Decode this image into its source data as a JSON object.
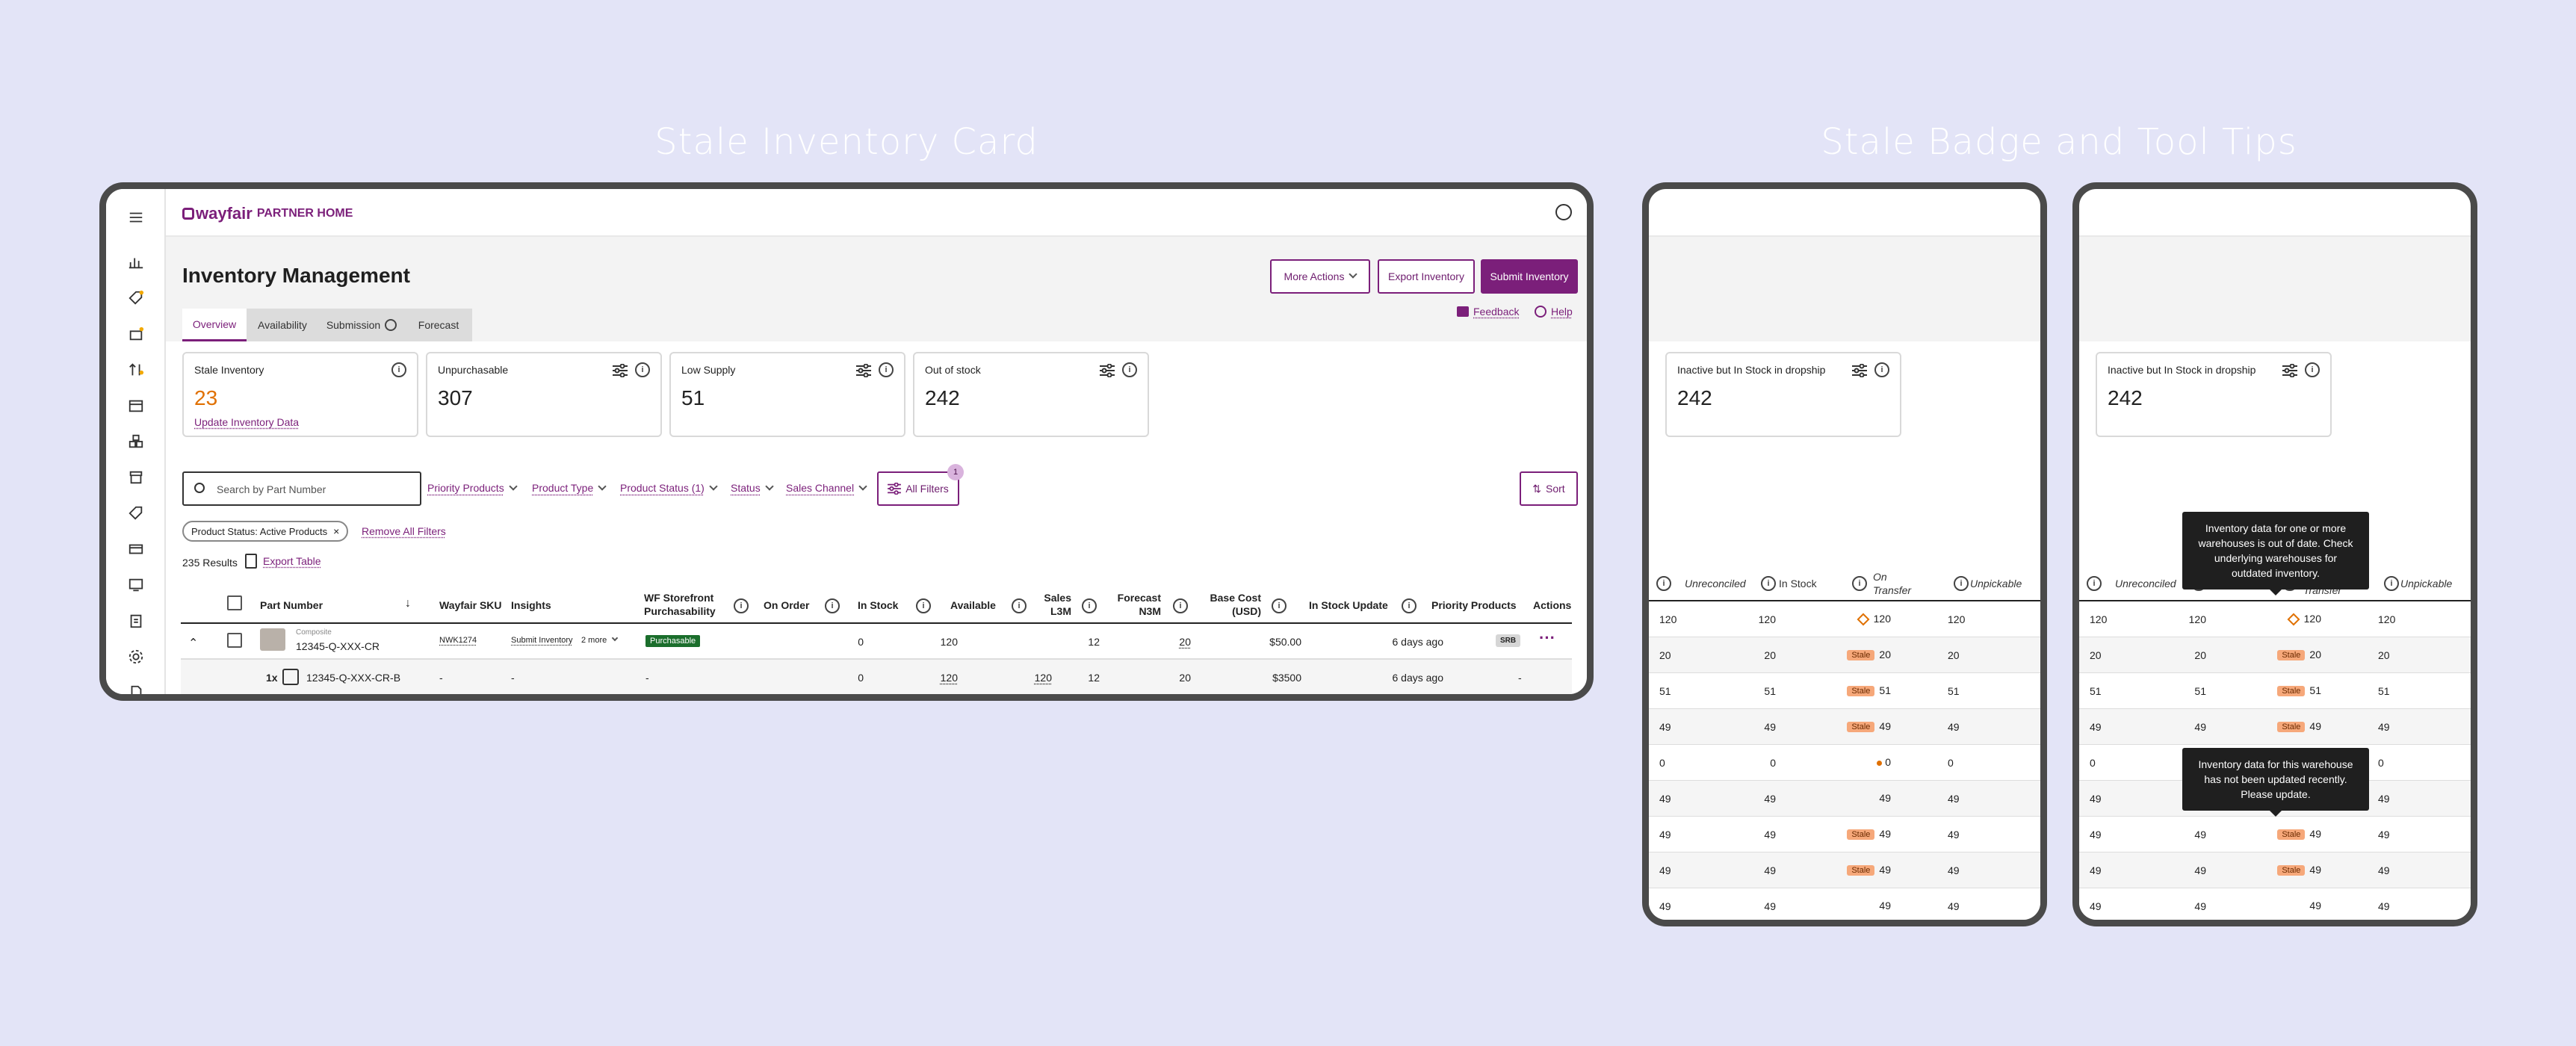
{
  "titles": {
    "card": "Stale Inventory Card",
    "badge": "Stale Badge and Tool Tips"
  },
  "brand": {
    "logo": "wayfair",
    "partner_home": "PARTNER HOME",
    "color": "#7b1f7a"
  },
  "page": {
    "title": "Inventory Management"
  },
  "actions": {
    "more": "More Actions",
    "export": "Export Inventory",
    "submit": "Submit Inventory",
    "feedback": "Feedback",
    "help": "Help"
  },
  "tabs": [
    "Overview",
    "Availability",
    "Submission",
    "Forecast"
  ],
  "cards": [
    {
      "title": "Stale Inventory",
      "value": "23",
      "link": "Update Inventory Data",
      "value_color": "#e07000"
    },
    {
      "title": "Unpurchasable",
      "value": "307"
    },
    {
      "title": "Low Supply",
      "value": "51"
    },
    {
      "title": "Out of stock",
      "value": "242"
    }
  ],
  "search": {
    "placeholder": "Search by Part Number"
  },
  "filters": [
    "Priority Products",
    "Product Type",
    "Product Status (1)",
    "Status",
    "Sales Channel"
  ],
  "all_filters": {
    "label": "All Filters",
    "count": "1"
  },
  "sort": "Sort",
  "chip": {
    "label": "Product Status: Active Products",
    "remove_all": "Remove All Filters"
  },
  "results": {
    "count": "235 Results",
    "export": "Export Table"
  },
  "table": {
    "headers": [
      "Part Number",
      "Wayfair SKU",
      "Insights",
      "WF Storefront Purchasability",
      "On Order",
      "In Stock",
      "Available",
      "Sales L3M",
      "Forecast N3M",
      "Base Cost (USD)",
      "In Stock Update",
      "Priority Products",
      "Actions"
    ],
    "row1": {
      "kind": "Composite",
      "part": "12345-Q-XXX-CR",
      "sku": "NWK1274",
      "insight": "Submit Inventory",
      "more": "2 more",
      "purch": "Purchasable",
      "on_order": "0",
      "in_stock": "120",
      "sales": "12",
      "forecast": "20",
      "cost": "$50.00",
      "update": "6 days ago",
      "priority": "SRB"
    },
    "row2": {
      "qty": "1x",
      "part": "12345-Q-XXX-CR-B",
      "sku": "-",
      "insight": "-",
      "purch": "-",
      "on_order": "0",
      "in_stock": "120",
      "available": "120",
      "sales": "12",
      "forecast": "20",
      "cost": "$3500",
      "update": "6 days ago",
      "priority": "-"
    }
  },
  "side": {
    "card_title": "Inactive but In Stock in dropship",
    "card_value": "242",
    "cols": [
      "Unreconciled",
      "In Stock",
      "On Transfer",
      "Unpickable"
    ],
    "stale_label": "Stale",
    "rows": [
      [
        "120",
        "120",
        "120",
        "120",
        "warn"
      ],
      [
        "20",
        "20",
        "20",
        "20",
        "stale"
      ],
      [
        "51",
        "51",
        "51",
        "51",
        "stale"
      ],
      [
        "49",
        "49",
        "49",
        "49",
        "stale"
      ],
      [
        "0",
        "0",
        "0",
        "0",
        "dot"
      ],
      [
        "49",
        "49",
        "49",
        "49",
        ""
      ],
      [
        "49",
        "49",
        "49",
        "49",
        "stale"
      ],
      [
        "49",
        "49",
        "49",
        "49",
        "stale"
      ],
      [
        "49",
        "49",
        "49",
        "49",
        ""
      ]
    ],
    "tooltip1": "Inventory data for one or more warehouses is out of date. Check underlying warehouses for outdated inventory.",
    "tooltip2": "Inventory data for this warehouse has not been updated recently. Please update."
  }
}
